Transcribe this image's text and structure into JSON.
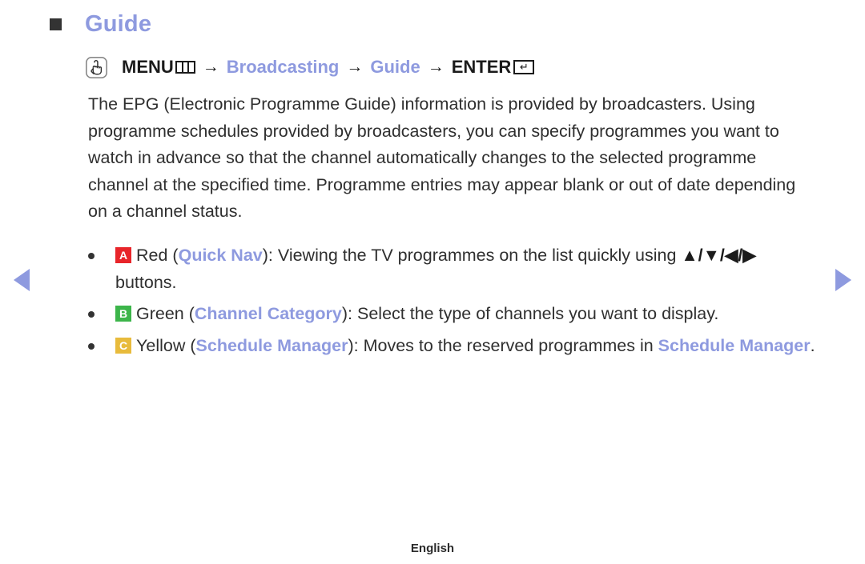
{
  "page": {
    "title": "Guide",
    "accent_color": "#8e9adf",
    "text_color": "#2f2f2f",
    "background_color": "#ffffff"
  },
  "nav": {
    "prev_label": "previous page",
    "next_label": "next page",
    "left_icon": "triangle-left-icon",
    "right_icon": "triangle-right-icon"
  },
  "path": {
    "icon": "touch-hand-icon",
    "segments": [
      {
        "label": "MENU",
        "accent": false,
        "glyph": "menu-bars-icon"
      },
      {
        "label": "Broadcasting",
        "accent": true,
        "glyph": ""
      },
      {
        "label": "Guide",
        "accent": true,
        "glyph": ""
      },
      {
        "label": "ENTER",
        "accent": false,
        "glyph": "enter-key-icon"
      }
    ],
    "separator": "→",
    "enter_glyph": "↵"
  },
  "body": {
    "paragraph": "The EPG (Electronic Programme Guide) information is provided by broadcasters. Using programme schedules provided by broadcasters, you can specify programmes you want to watch in advance so that the channel automatically changes to the selected programme channel at the specified time. Programme entries may appear blank or out of date depending on a channel status."
  },
  "bullets": [
    {
      "badge": "A",
      "badge_color": "#e8252a",
      "colour_name": "Red",
      "open_paren": " (",
      "feature": "Quick Nav",
      "close_paren": "): ",
      "text_before_keys": "Viewing the TV programmes on the list quickly using ",
      "keys": "▲/▼/◀/▶",
      "text_after_keys": " buttons.",
      "trailing_accent": "",
      "trailing_period": ""
    },
    {
      "badge": "B",
      "badge_color": "#3cb54a",
      "colour_name": "Green",
      "open_paren": " (",
      "feature": "Channel Category",
      "close_paren": "): ",
      "text_before_keys": "Select the type of channels you want to display.",
      "keys": "",
      "text_after_keys": "",
      "trailing_accent": "",
      "trailing_period": ""
    },
    {
      "badge": "C",
      "badge_color": "#e8bb3c",
      "colour_name": "Yellow",
      "open_paren": " (",
      "feature": "Schedule Manager",
      "close_paren": "): ",
      "text_before_keys": "Moves to the reserved programmes in ",
      "keys": "",
      "text_after_keys": "",
      "trailing_accent": "Schedule Manager",
      "trailing_period": "."
    }
  ],
  "footer": {
    "language": "English"
  }
}
